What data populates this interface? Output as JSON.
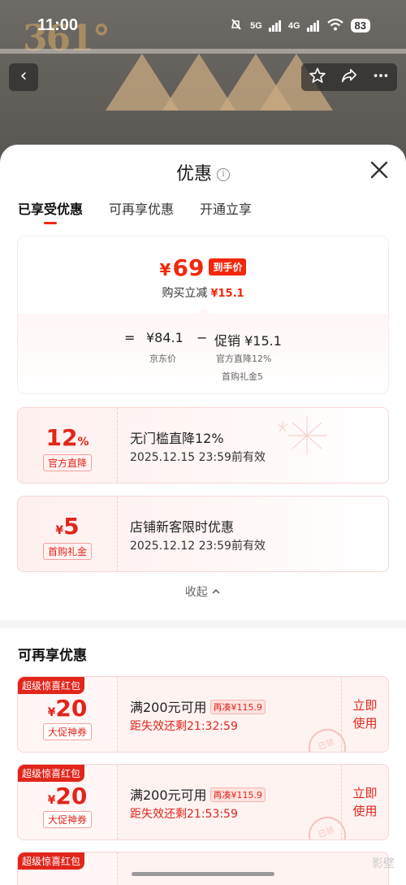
{
  "status_bar": {
    "time": "11:00",
    "net1": "5G",
    "net2": "4G",
    "battery": "83"
  },
  "backdrop": {
    "logo_text": "361°"
  },
  "header": {
    "title": "优惠"
  },
  "tabs": [
    {
      "label": "已享受优惠"
    },
    {
      "label": "可再享优惠"
    },
    {
      "label": "开通立享"
    }
  ],
  "summary": {
    "currency": "¥",
    "final_price": "69",
    "final_badge": "到手价",
    "reduce_label": "购买立减",
    "reduce_amount": "¥15.1",
    "eq": "=",
    "jd_price": "¥84.1",
    "minus": "−",
    "promo": "促销 ¥15.1",
    "jd_price_label": "京东价",
    "promo_detail_1": "官方直降12%",
    "promo_detail_2": "首购礼金5"
  },
  "applied_coupons": [
    {
      "value": "12",
      "unit": "%",
      "prefix": "",
      "tag": "官方直降",
      "title": "无门槛直降12%",
      "expiry": "2025.12.15 23:59前有效"
    },
    {
      "value": "5",
      "unit": "",
      "prefix": "¥",
      "tag": "首购礼金",
      "title": "店铺新客限时优惠",
      "expiry": "2025.12.12 23:59前有效"
    }
  ],
  "collapse_label": "收起",
  "more_section": {
    "title": "可再享优惠"
  },
  "red_packets": [
    {
      "corner": "超级惊喜红包",
      "prefix": "¥",
      "value": "20",
      "tag": "大促神券",
      "title": "满200元可用",
      "addon": "再凑¥115.9",
      "countdown": "距失效还剩21:32:59",
      "action_1": "立即",
      "action_2": "使用",
      "stamp": "已领"
    },
    {
      "corner": "超级惊喜红包",
      "prefix": "¥",
      "value": "20",
      "tag": "大促神券",
      "title": "满200元可用",
      "addon": "再凑¥115.9",
      "countdown": "距失效还剩21:53:59",
      "action_1": "立即",
      "action_2": "使用",
      "stamp": "已领"
    },
    {
      "corner": "超级惊喜红包"
    }
  ],
  "watermark": "影壁",
  "colors": {
    "accent": "#f2270c",
    "coupon_red": "#e1251b"
  }
}
